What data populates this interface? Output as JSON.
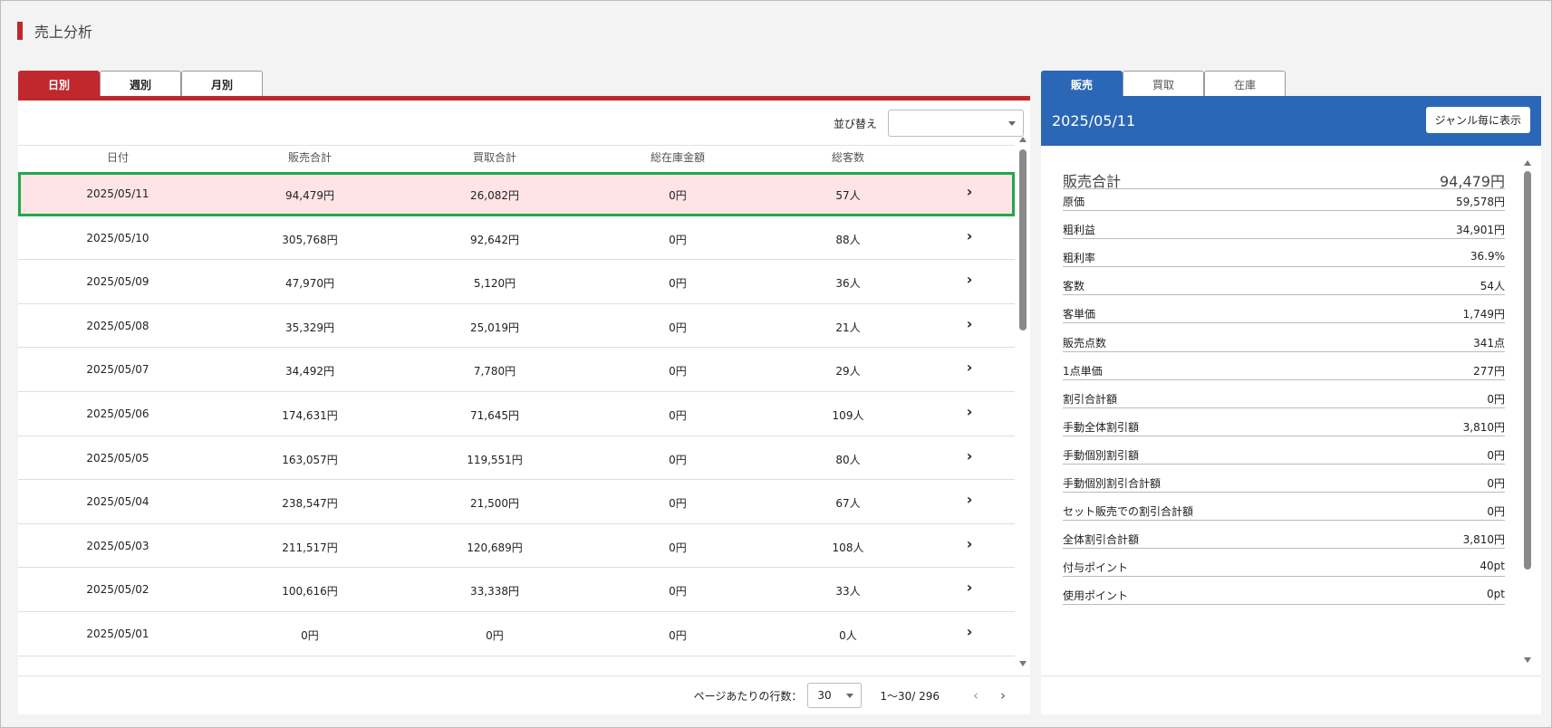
{
  "page_title": "売上分析",
  "left_tabs": [
    "日別",
    "週別",
    "月別"
  ],
  "sort_label": "並び替え",
  "columns": [
    "日付",
    "販売合計",
    "買取合計",
    "総在庫金額",
    "総客数"
  ],
  "rows": [
    {
      "date": "2025/05/11",
      "sales": "94,479円",
      "purchase": "26,082円",
      "stock": "0円",
      "customers": "57人"
    },
    {
      "date": "2025/05/10",
      "sales": "305,768円",
      "purchase": "92,642円",
      "stock": "0円",
      "customers": "88人"
    },
    {
      "date": "2025/05/09",
      "sales": "47,970円",
      "purchase": "5,120円",
      "stock": "0円",
      "customers": "36人"
    },
    {
      "date": "2025/05/08",
      "sales": "35,329円",
      "purchase": "25,019円",
      "stock": "0円",
      "customers": "21人"
    },
    {
      "date": "2025/05/07",
      "sales": "34,492円",
      "purchase": "7,780円",
      "stock": "0円",
      "customers": "29人"
    },
    {
      "date": "2025/05/06",
      "sales": "174,631円",
      "purchase": "71,645円",
      "stock": "0円",
      "customers": "109人"
    },
    {
      "date": "2025/05/05",
      "sales": "163,057円",
      "purchase": "119,551円",
      "stock": "0円",
      "customers": "80人"
    },
    {
      "date": "2025/05/04",
      "sales": "238,547円",
      "purchase": "21,500円",
      "stock": "0円",
      "customers": "67人"
    },
    {
      "date": "2025/05/03",
      "sales": "211,517円",
      "purchase": "120,689円",
      "stock": "0円",
      "customers": "108人"
    },
    {
      "date": "2025/05/02",
      "sales": "100,616円",
      "purchase": "33,338円",
      "stock": "0円",
      "customers": "33人"
    },
    {
      "date": "2025/05/01",
      "sales": "0円",
      "purchase": "0円",
      "stock": "0円",
      "customers": "0人"
    }
  ],
  "chevron": "›",
  "footer": {
    "rows_per_page_label": "ページあたりの行数：",
    "rows_per_page": "30",
    "range": "1～30/ 296",
    "prev": "‹",
    "next": "›"
  },
  "right_tabs": [
    "販売",
    "買取",
    "在庫"
  ],
  "right_date": "2025/05/11",
  "genre_button": "ジャンル毎に表示",
  "summary": {
    "label": "販売合計",
    "value": "94,479円"
  },
  "metrics": [
    {
      "label": "原価",
      "value": "59,578円"
    },
    {
      "label": "粗利益",
      "value": "34,901円"
    },
    {
      "label": "粗利率",
      "value": "36.9%"
    },
    {
      "label": "客数",
      "value": "54人"
    },
    {
      "label": "客単価",
      "value": "1,749円"
    },
    {
      "label": "販売点数",
      "value": "341点"
    },
    {
      "label": "1点単価",
      "value": "277円"
    },
    {
      "label": "割引合計額",
      "value": "0円"
    },
    {
      "label": "手動全体割引額",
      "value": "3,810円"
    },
    {
      "label": "手動個別割引額",
      "value": "0円"
    },
    {
      "label": "手動個別割引合計額",
      "value": "0円"
    },
    {
      "label": "セット販売での割引合計額",
      "value": "0円"
    },
    {
      "label": "全体割引合計額",
      "value": "3,810円"
    },
    {
      "label": "付与ポイント",
      "value": "40pt"
    },
    {
      "label": "使用ポイント",
      "value": "0pt"
    }
  ]
}
